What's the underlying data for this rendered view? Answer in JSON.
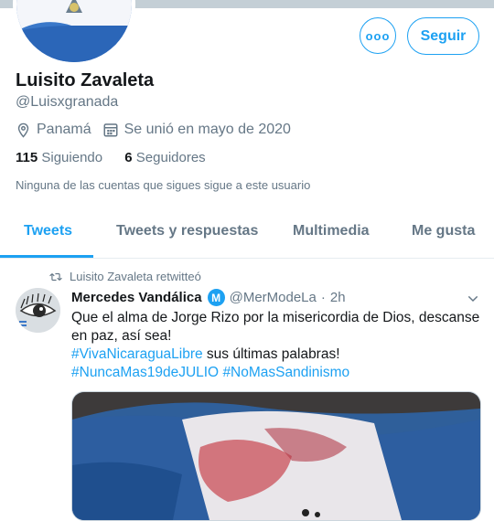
{
  "profile": {
    "name": "Luisito Zavaleta",
    "handle": "@Luisxgranada",
    "location": "Panamá",
    "joined": "Se unió en mayo de 2020",
    "following_count": "115",
    "following_label": "Siguiendo",
    "followers_count": "6",
    "followers_label": "Seguidores",
    "follow_note": "Ninguna de las cuentas que sigues sigue a este usuario",
    "follow_button": "Seguir",
    "more_button": "ooo"
  },
  "tabs": [
    {
      "label": "Tweets",
      "active": true
    },
    {
      "label": "Tweets y respuestas",
      "active": false
    },
    {
      "label": "Multimedia",
      "active": false
    },
    {
      "label": "Me gusta",
      "active": false
    }
  ],
  "tweet": {
    "retweet_label": "Luisito Zavaleta retwitteó",
    "author_name": "Mercedes Vandálica",
    "badge": "M",
    "author_handle": "@MerModeLa",
    "separator": "·",
    "time": "2h",
    "text_line1": "Que el alma de Jorge Rizo por la misericordia de Dios, descanse en paz, así sea!",
    "hashtag1": "#VivaNicaraguaLibre",
    "text_line2": " sus últimas palabras!",
    "hashtag2": "#NuncaMas19deJULIO",
    "hashtag3": "#NoMasSandinismo"
  },
  "colors": {
    "accent": "#1da1f2",
    "secondary_text": "#657786",
    "primary_text": "#14171a"
  },
  "icons": [
    "location-pin-icon",
    "calendar-icon",
    "retweet-icon",
    "chevron-down-icon",
    "more-icon"
  ]
}
